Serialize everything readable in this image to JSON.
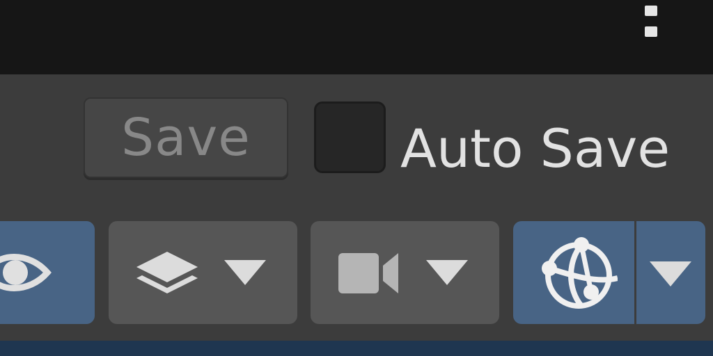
{
  "window": {
    "menu_icon": "more-vertical-icon"
  },
  "toolbar": {
    "save_label": "Save",
    "auto_save_label": "Auto Save",
    "auto_save_checked": false
  },
  "view_buttons": [
    {
      "name": "visibility",
      "icon": "eye-icon",
      "active": true
    },
    {
      "name": "layers",
      "icon": "layers-icon",
      "dropdown": true,
      "active": false
    },
    {
      "name": "camera",
      "icon": "video-camera-icon",
      "dropdown": true,
      "active": false
    },
    {
      "name": "gizmos",
      "icon": "gizmo-sphere-icon",
      "dropdown": true,
      "active": true
    }
  ],
  "colors": {
    "titlebar": "#161616",
    "panel": "#3c3c3c",
    "active_blue": "#486485",
    "inactive_button": "#565656",
    "text": "#e2e2e2",
    "bottom_strip": "#1f3650"
  }
}
